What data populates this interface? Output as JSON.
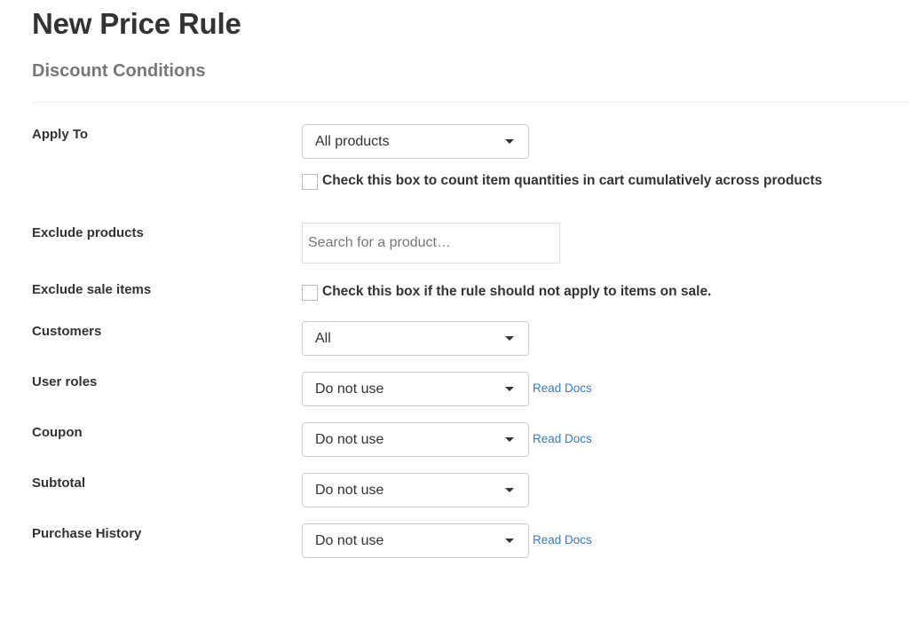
{
  "header": {
    "title": "New Price Rule",
    "section": "Discount Conditions"
  },
  "form": {
    "apply_to": {
      "label": "Apply To",
      "value": "All products",
      "checkbox_label": "Check this box to count item quantities in cart cumulatively across products",
      "checked": false
    },
    "exclude_products": {
      "label": "Exclude products",
      "placeholder": "Search for a product…",
      "value": ""
    },
    "exclude_sale_items": {
      "label": "Exclude sale items",
      "checkbox_label": "Check this box if the rule should not apply to items on sale.",
      "checked": false
    },
    "customers": {
      "label": "Customers",
      "value": "All"
    },
    "user_roles": {
      "label": "User roles",
      "value": "Do not use",
      "link": "Read Docs"
    },
    "coupon": {
      "label": "Coupon",
      "value": "Do not use",
      "link": "Read Docs"
    },
    "subtotal": {
      "label": "Subtotal",
      "value": "Do not use"
    },
    "purchase_history": {
      "label": "Purchase History",
      "value": "Do not use",
      "link": "Read Docs"
    }
  },
  "colors": {
    "text": "#333333",
    "muted": "#777777",
    "link": "#3c7ab6",
    "border": "#cccccc"
  }
}
